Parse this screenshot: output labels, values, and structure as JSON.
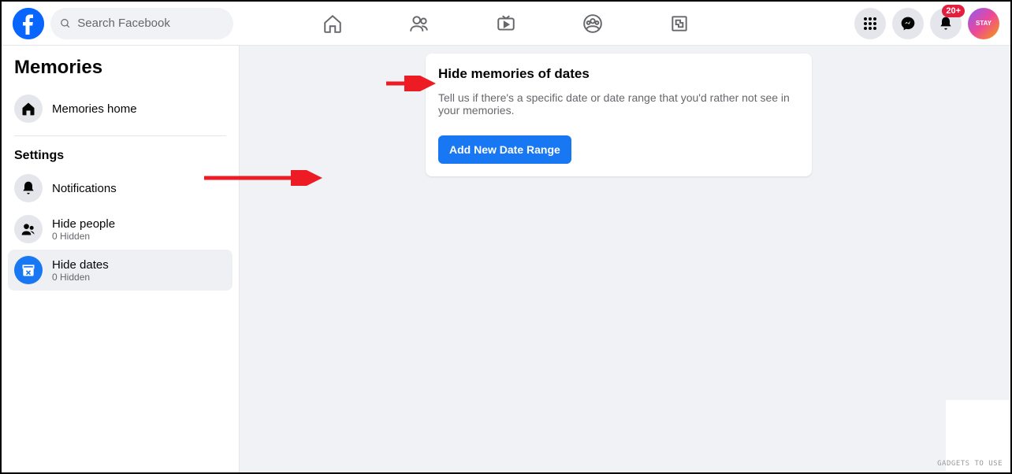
{
  "header": {
    "search_placeholder": "Search Facebook",
    "badge": "20+"
  },
  "sidebar": {
    "title": "Memories",
    "home_label": "Memories home",
    "settings_label": "Settings",
    "notifications_label": "Notifications",
    "hide_people": {
      "label": "Hide people",
      "sub": "0 Hidden"
    },
    "hide_dates": {
      "label": "Hide dates",
      "sub": "0 Hidden"
    }
  },
  "card": {
    "title": "Hide memories of dates",
    "desc": "Tell us if there's a specific date or date range that you'd rather not see in your memories.",
    "button": "Add New Date Range"
  },
  "watermark": "GADGETS TO USE"
}
